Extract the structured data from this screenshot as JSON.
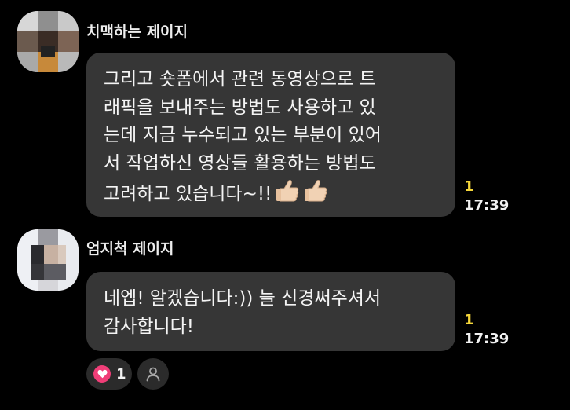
{
  "messages": [
    {
      "sender": "치맥하는 제이지",
      "lines": [
        "그리고 숏폼에서 관련 동영상으로 트",
        "래픽을 보내주는 방법도 사용하고 있",
        "는데 지금 누수되고 있는 부분이 있어",
        "서 작업하신 영상들 활용하는 방법도",
        "고려하고 있습니다~!!"
      ],
      "emoji": [
        "thumbs-up",
        "thumbs-up"
      ],
      "unread": "1",
      "time": "17:39"
    },
    {
      "sender": "엄지척 제이지",
      "lines": [
        "네엡! 알겠습니다:)) 늘 신경써주셔서",
        "감사합니다!"
      ],
      "unread": "1",
      "time": "17:39"
    }
  ],
  "reactions": {
    "icon": "heart-icon",
    "count": "1",
    "profile_icon": "person-icon"
  },
  "colors": {
    "background": "#000000",
    "bubble": "#363636",
    "unread": "#f5d63a",
    "heart": "#f03e78"
  }
}
